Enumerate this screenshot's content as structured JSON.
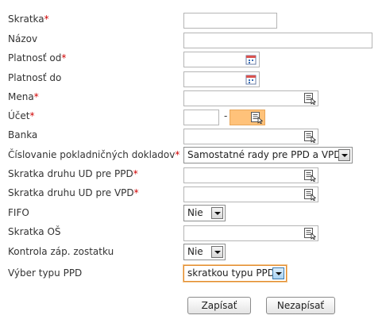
{
  "form": {
    "skratka": {
      "label": "Skratka",
      "required": "*",
      "value": ""
    },
    "nazov": {
      "label": "Názov",
      "value": ""
    },
    "platnost_od": {
      "label": "Platnosť od",
      "required": "*",
      "value": "",
      "icon": "calendar-icon"
    },
    "platnost_do": {
      "label": "Platnosť do",
      "value": "",
      "icon": "calendar-icon"
    },
    "mena": {
      "label": "Mena",
      "required": "*",
      "value": "",
      "icon": "lookup-list-icon"
    },
    "ucet": {
      "label": "Účet",
      "required": "*",
      "value_prefix": "",
      "separator": "-",
      "value_suffix": "",
      "icon": "lookup-list-icon"
    },
    "banka": {
      "label": "Banka",
      "value": "",
      "icon": "lookup-list-icon"
    },
    "cislovanie": {
      "label": "Číslovanie pokladničných dokladov",
      "required": "*",
      "selected": "Samostatné rady pre PPD a VPD"
    },
    "skratka_ppd": {
      "label": "Skratka druhu UD pre PPD",
      "required": "*",
      "value": "",
      "icon": "lookup-list-icon"
    },
    "skratka_vpd": {
      "label": "Skratka druhu UD pre VPD",
      "required": "*",
      "value": "",
      "icon": "lookup-list-icon"
    },
    "fifo": {
      "label": "FIFO",
      "selected": "Nie"
    },
    "skratka_os": {
      "label": "Skratka OŠ",
      "value": "",
      "icon": "lookup-list-icon"
    },
    "kontrola": {
      "label": "Kontrola záp. zostatku",
      "selected": "Nie"
    },
    "vyber_typu": {
      "label": "Výber typu PPD",
      "selected": "skratkou typu PPD"
    }
  },
  "buttons": {
    "save": "Zapísať",
    "cancel": "Nezapísať"
  },
  "colors": {
    "required": "#d00000",
    "highlight": "#ffc27a",
    "focus_border": "#e28a2b"
  }
}
